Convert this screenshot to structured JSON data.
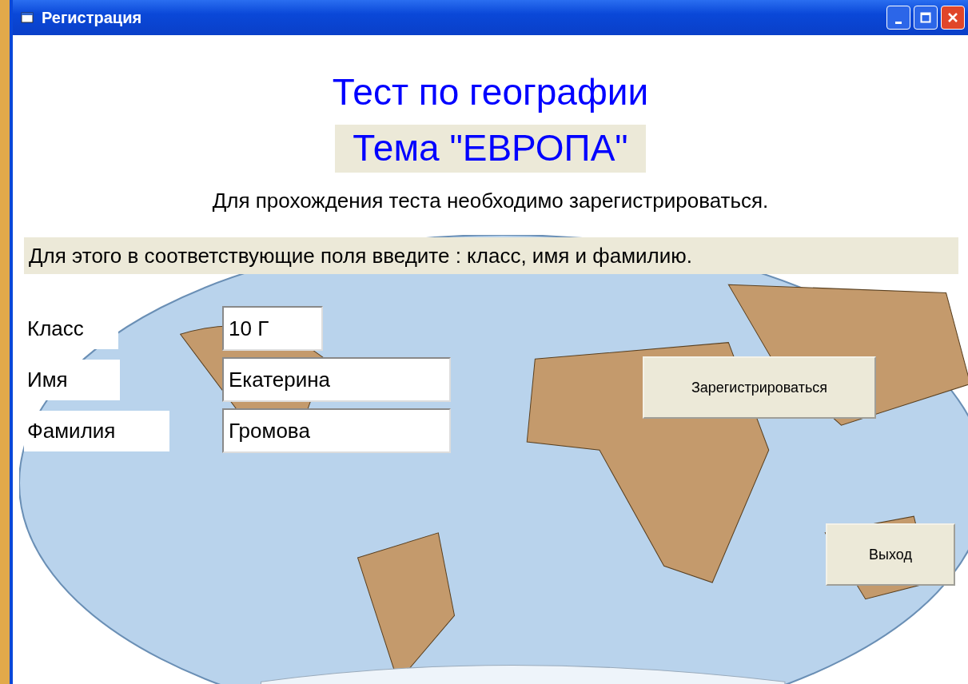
{
  "window": {
    "title": "Регистрация"
  },
  "heading": "Тест по географии",
  "topic": "Тема \"ЕВРОПА\"",
  "intro": "Для прохождения теста необходимо зарегистрироваться.",
  "instruction": "Для этого в соответствующие поля введите : класс, имя и фамилию.",
  "fields": [
    {
      "label": "Класс",
      "value": "10 Г"
    },
    {
      "label": "Имя",
      "value": "Екатерина"
    },
    {
      "label": "Фамилия",
      "value": "Громова"
    }
  ],
  "buttons": [
    {
      "label": "Зарегистрироваться"
    },
    {
      "label": "Выход"
    }
  ]
}
